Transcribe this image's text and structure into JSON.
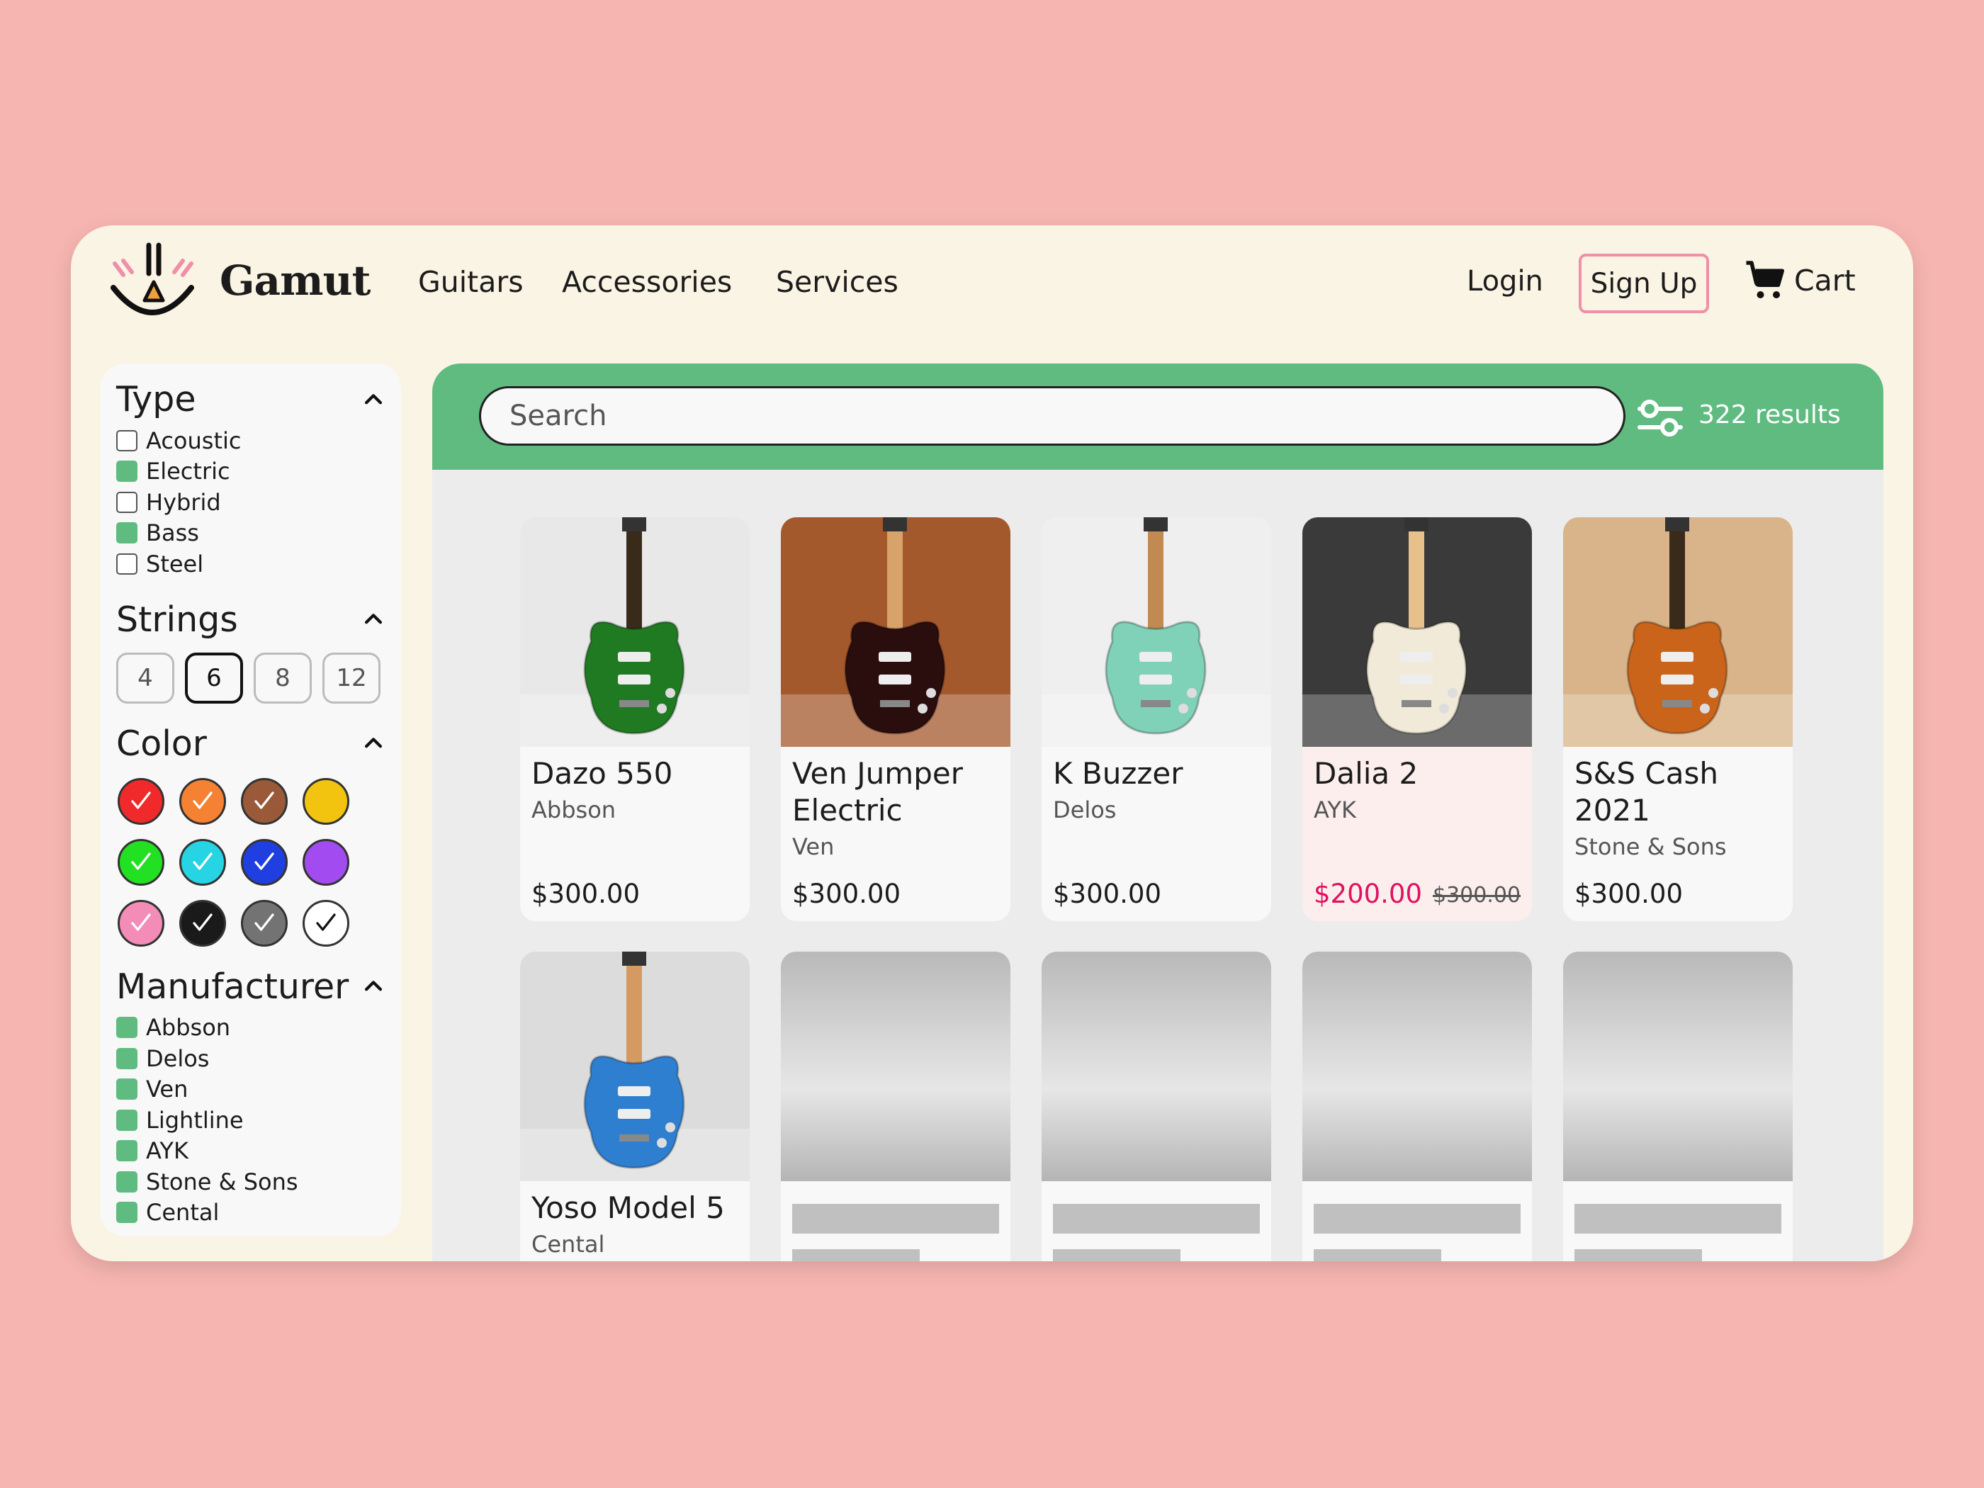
{
  "brand": {
    "name": "Gamut"
  },
  "nav": [
    "Guitars",
    "Accessories",
    "Services"
  ],
  "header": {
    "login": "Login",
    "signup": "Sign Up",
    "cart": "Cart"
  },
  "colors": {
    "accent_green": "#5fbb80",
    "sale_red": "#e0115f",
    "signup_border": "#f08fa8",
    "background": "#f6b5b0"
  },
  "filters": {
    "type": {
      "title": "Type",
      "items": [
        {
          "label": "Acoustic",
          "checked": false
        },
        {
          "label": "Electric",
          "checked": true
        },
        {
          "label": "Hybrid",
          "checked": false
        },
        {
          "label": "Bass",
          "checked": true
        },
        {
          "label": "Steel",
          "checked": false
        }
      ]
    },
    "strings": {
      "title": "Strings",
      "options": [
        "4",
        "6",
        "8",
        "12"
      ],
      "selected": "6"
    },
    "color": {
      "title": "Color",
      "swatches": [
        {
          "name": "red",
          "hex": "#f02a2a",
          "checked": true
        },
        {
          "name": "orange",
          "hex": "#f58233",
          "checked": true
        },
        {
          "name": "brown",
          "hex": "#9a5a3a",
          "checked": true
        },
        {
          "name": "yellow",
          "hex": "#f2c40f",
          "checked": false
        },
        {
          "name": "green",
          "hex": "#22e022",
          "checked": true
        },
        {
          "name": "cyan",
          "hex": "#26d4e4",
          "checked": true
        },
        {
          "name": "blue",
          "hex": "#1f3fe0",
          "checked": true
        },
        {
          "name": "purple",
          "hex": "#a14bf0",
          "checked": false
        },
        {
          "name": "pink",
          "hex": "#f48cb8",
          "checked": true
        },
        {
          "name": "black",
          "hex": "#1a1a1a",
          "checked": true
        },
        {
          "name": "gray",
          "hex": "#737373",
          "checked": true
        },
        {
          "name": "white",
          "hex": "#ffffff",
          "checked": true
        }
      ]
    },
    "manufacturer": {
      "title": "Manufacturer",
      "items": [
        {
          "label": "Abbson",
          "checked": true
        },
        {
          "label": "Delos",
          "checked": true
        },
        {
          "label": "Ven",
          "checked": true
        },
        {
          "label": "Lightline",
          "checked": true
        },
        {
          "label": "AYK",
          "checked": true
        },
        {
          "label": "Stone & Sons",
          "checked": true
        },
        {
          "label": "Cental",
          "checked": true
        }
      ]
    }
  },
  "search": {
    "placeholder": "Search",
    "results": "322 results"
  },
  "products": [
    {
      "name": "Dazo 550",
      "maker": "Abbson",
      "price": "$300.00",
      "bg": "#e8e8e8",
      "body": "#1f7a22",
      "neck": "#3a2a1a"
    },
    {
      "name": "Ven Jumper Electric",
      "maker": "Ven",
      "price": "$300.00",
      "bg": "#a4592d",
      "body": "#2a0d0d",
      "neck": "#d7a36a"
    },
    {
      "name": "K Buzzer",
      "maker": "Delos",
      "price": "$300.00",
      "bg": "#efefef",
      "body": "#7fd1b8",
      "neck": "#c08a52"
    },
    {
      "name": "Dalia 2",
      "maker": "AYK",
      "price": "$200.00",
      "old_price": "$300.00",
      "sale": true,
      "bg": "#3a3a3a",
      "body": "#f1ead8",
      "neck": "#e6c18a"
    },
    {
      "name": "S&S Cash 2021",
      "maker": "Stone & Sons",
      "price": "$300.00",
      "bg": "#d9b48a",
      "body": "#c9641a",
      "neck": "#3a2a1a"
    },
    {
      "name": "Yoso Model 5",
      "maker": "Cental",
      "price": "",
      "bg": "#dcdcdc",
      "body": "#2f7fd0",
      "neck": "#d49a62"
    }
  ],
  "skeleton_count": 4
}
